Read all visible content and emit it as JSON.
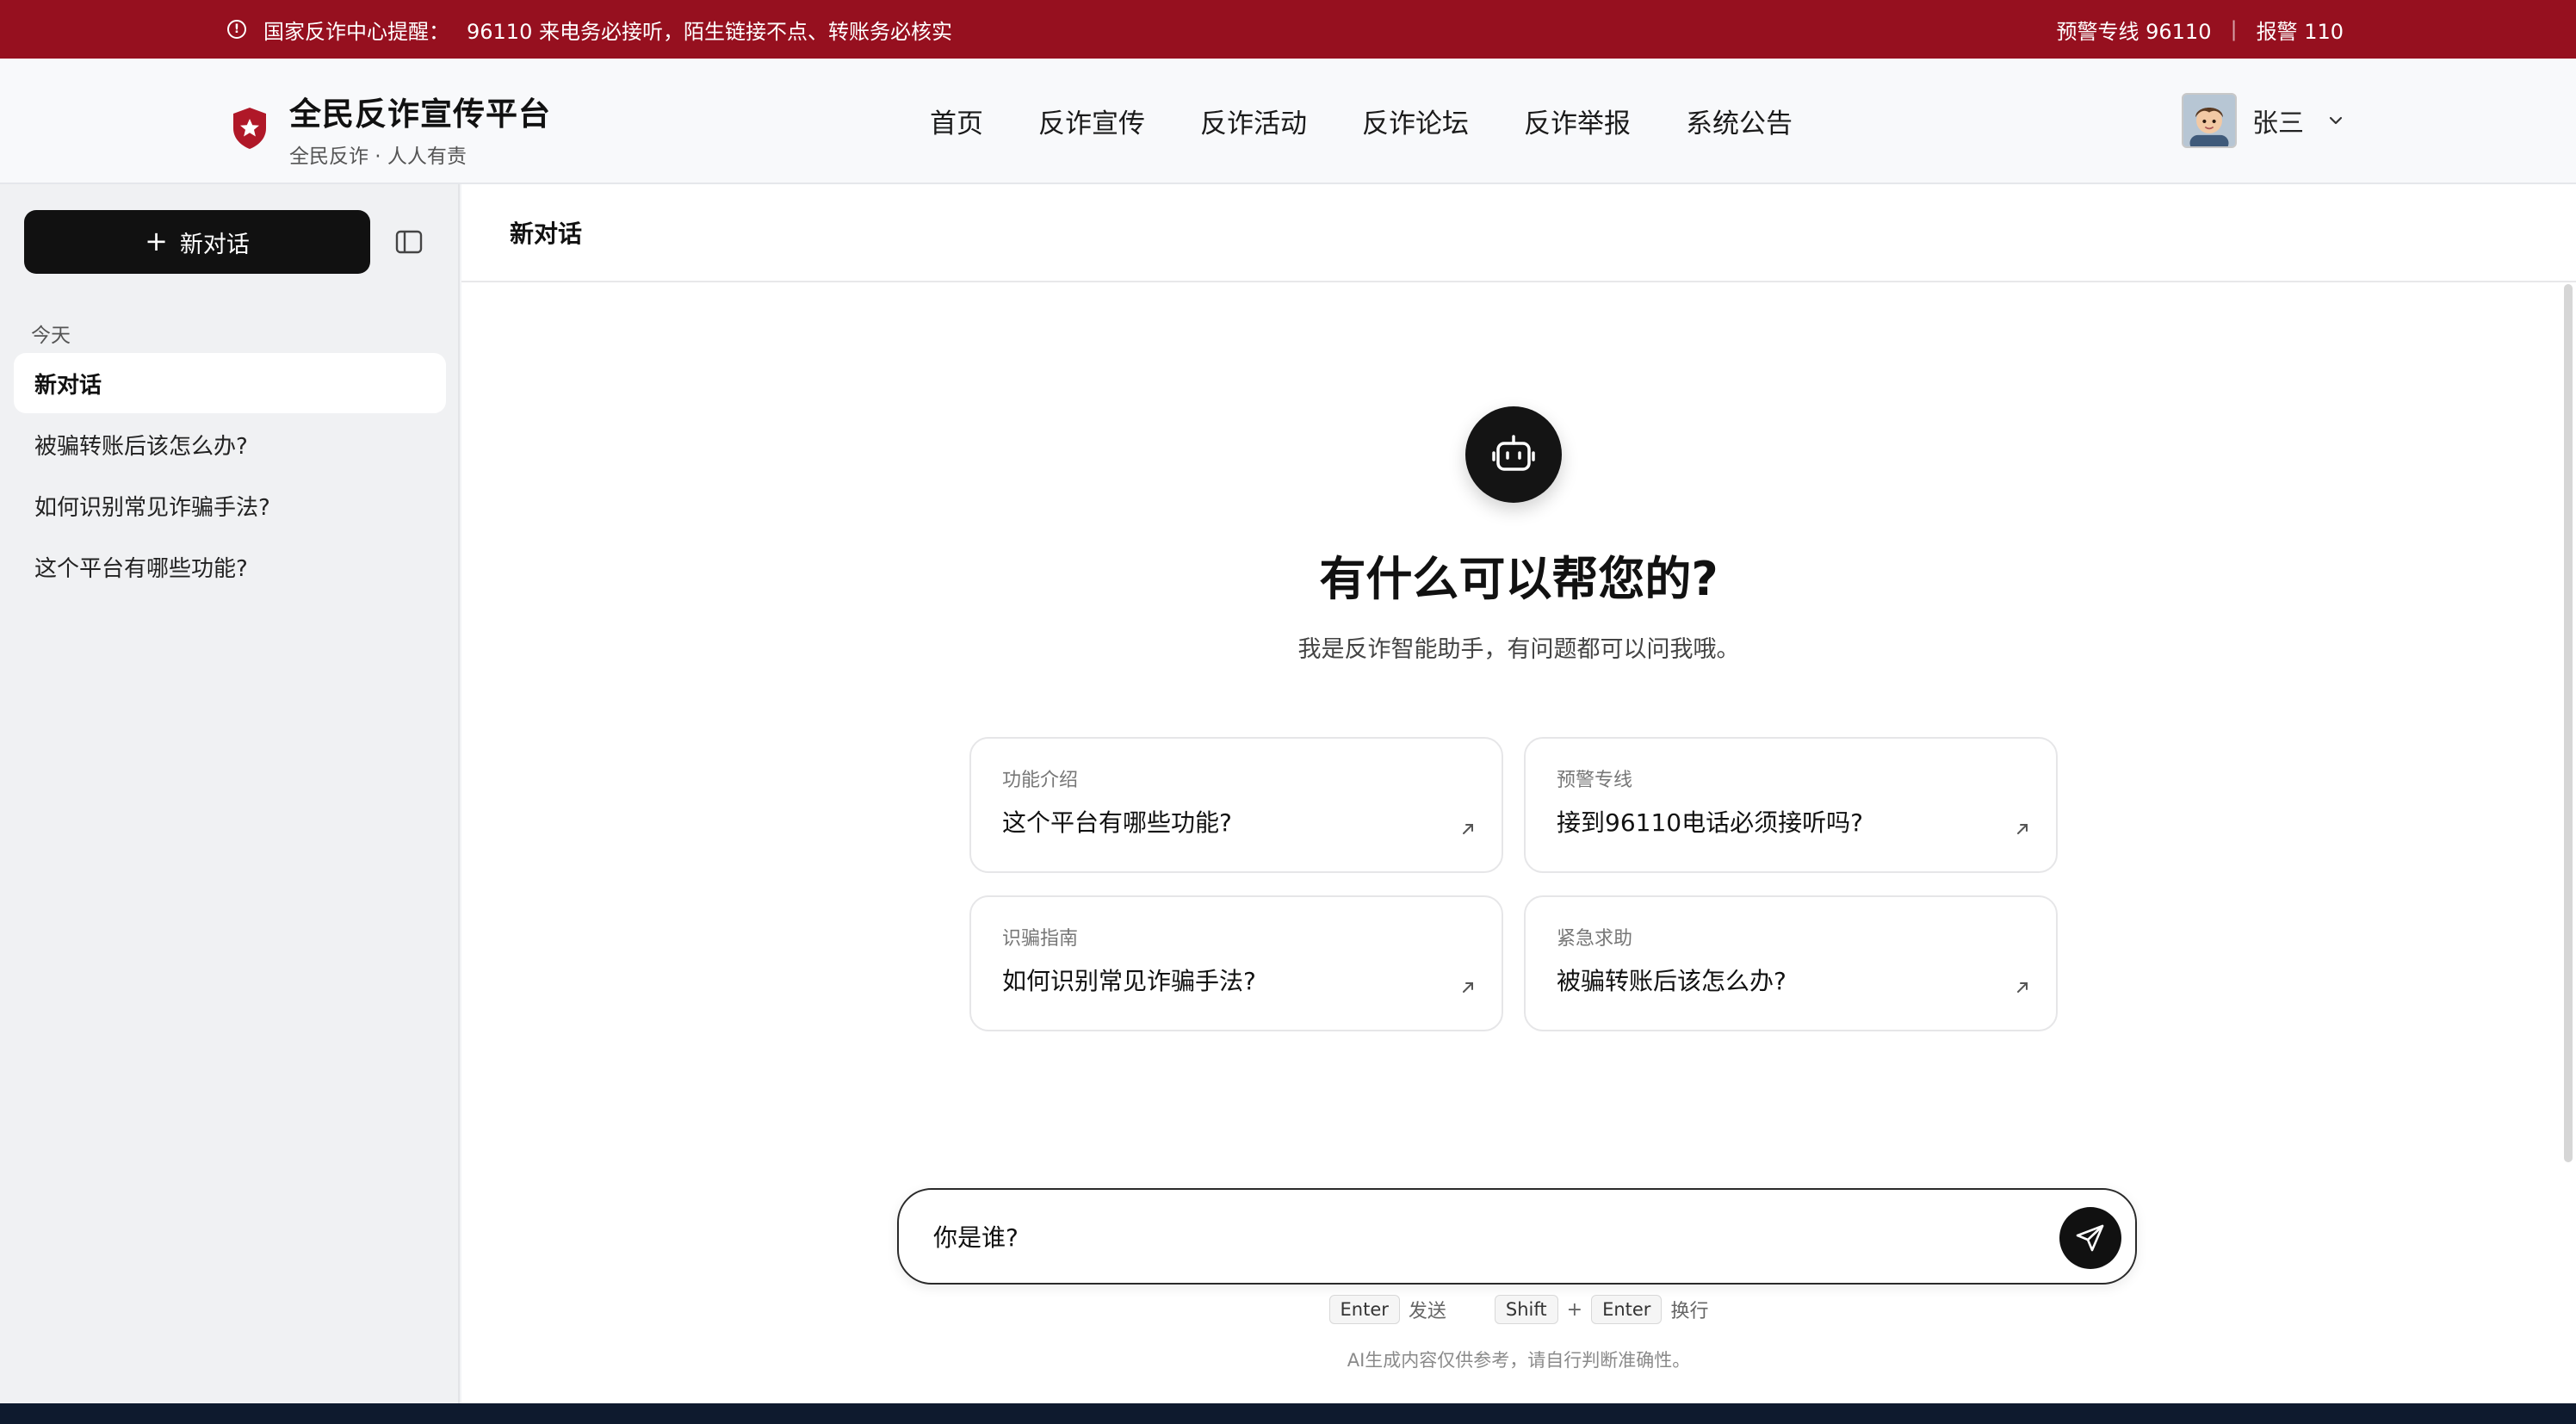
{
  "alert": {
    "prefix": "国家反诈中心提醒：",
    "message": "96110 来电务必接听，陌生链接不点、转账务必核实",
    "hotline": "预警专线 96110",
    "separator": "|",
    "police": "报警 110"
  },
  "brand": {
    "title": "全民反诈宣传平台",
    "subtitle": "全民反诈 · 人人有责"
  },
  "nav": {
    "items": [
      "首页",
      "反诈宣传",
      "反诈活动",
      "反诈论坛",
      "反诈举报",
      "系统公告"
    ]
  },
  "user": {
    "name": "张三"
  },
  "sidebar": {
    "new_chat_label": "新对话",
    "section_label": "今天",
    "conversations": [
      {
        "title": "新对话",
        "active": true
      },
      {
        "title": "被骗转账后该怎么办?",
        "active": false
      },
      {
        "title": "如何识别常见诈骗手法?",
        "active": false
      },
      {
        "title": "这个平台有哪些功能?",
        "active": false
      }
    ]
  },
  "main": {
    "header_title": "新对话",
    "hero_title": "有什么可以帮您的?",
    "hero_subtitle": "我是反诈智能助手，有问题都可以问我哦。",
    "suggestions": [
      {
        "category": "功能介绍",
        "question": "这个平台有哪些功能?"
      },
      {
        "category": "预警专线",
        "question": "接到96110电话必须接听吗?"
      },
      {
        "category": "识骗指南",
        "question": "如何识别常见诈骗手法?"
      },
      {
        "category": "紧急求助",
        "question": "被骗转账后该怎么办?"
      }
    ],
    "input_value": "你是谁?",
    "hints": {
      "enter_key": "Enter",
      "send_label": "发送",
      "shift_key": "Shift",
      "plus": "+",
      "enter_key2": "Enter",
      "newline_label": "换行"
    },
    "disclaimer": "AI生成内容仅供参考，请自行判断准确性。"
  },
  "colors": {
    "alert_bg": "#96101f",
    "primary_dark": "#111111",
    "shield_red": "#b01828"
  }
}
